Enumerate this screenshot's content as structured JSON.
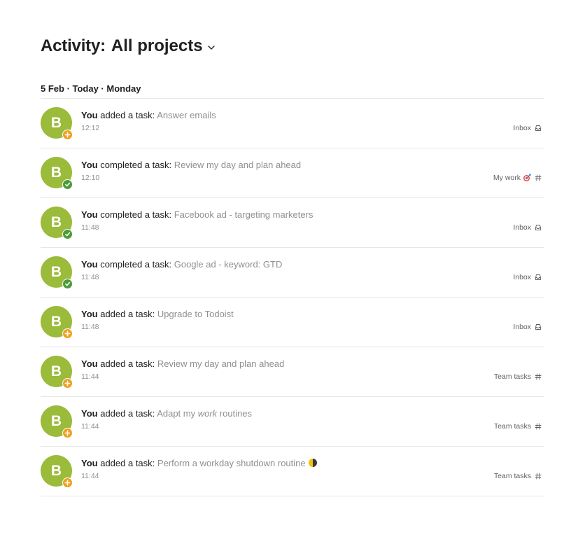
{
  "header": {
    "title": "Activity:",
    "project": "All projects"
  },
  "day": {
    "label": "5 Feb · Today · Monday"
  },
  "activity": [
    {
      "avatar": "B",
      "actor": "You",
      "action": "added a task:",
      "type": "added",
      "task": "Answer emails",
      "time": "12:12",
      "project": "Inbox",
      "project_icon": "inbox-icon"
    },
    {
      "avatar": "B",
      "actor": "You",
      "action": "completed a task:",
      "type": "completed",
      "task": "Review my day and plan ahead",
      "time": "12:10",
      "project": "My work",
      "project_icon": "hash-icon",
      "project_emoji": "target-icon"
    },
    {
      "avatar": "B",
      "actor": "You",
      "action": "completed a task:",
      "type": "completed",
      "task": "Facebook ad - targeting marketers",
      "time": "11:48",
      "project": "Inbox",
      "project_icon": "inbox-icon"
    },
    {
      "avatar": "B",
      "actor": "You",
      "action": "completed a task:",
      "type": "completed",
      "task": "Google ad - keyword: GTD",
      "time": "11:48",
      "project": "Inbox",
      "project_icon": "inbox-icon"
    },
    {
      "avatar": "B",
      "actor": "You",
      "action": "added a task:",
      "type": "added",
      "task": "Upgrade to Todoist",
      "time": "11:48",
      "project": "Inbox",
      "project_icon": "inbox-icon"
    },
    {
      "avatar": "B",
      "actor": "You",
      "action": "added a task:",
      "type": "added",
      "task": "Review my day and plan ahead",
      "time": "11:44",
      "project": "Team tasks",
      "project_icon": "hash-icon"
    },
    {
      "avatar": "B",
      "actor": "You",
      "action": "added a task:",
      "type": "added",
      "task_pre": "Adapt my ",
      "task_em": "work",
      "task_post": " routines",
      "time": "11:44",
      "project": "Team tasks",
      "project_icon": "hash-icon"
    },
    {
      "avatar": "B",
      "actor": "You",
      "action": "added a task:",
      "type": "added",
      "task": "Perform a workday shutdown routine",
      "task_emoji": "half-moon-icon",
      "time": "11:44",
      "project": "Team tasks",
      "project_icon": "hash-icon"
    }
  ],
  "colors": {
    "avatar": "#9bbb3a",
    "added_badge": "#f0a020",
    "completed_badge": "#4b9b38"
  }
}
